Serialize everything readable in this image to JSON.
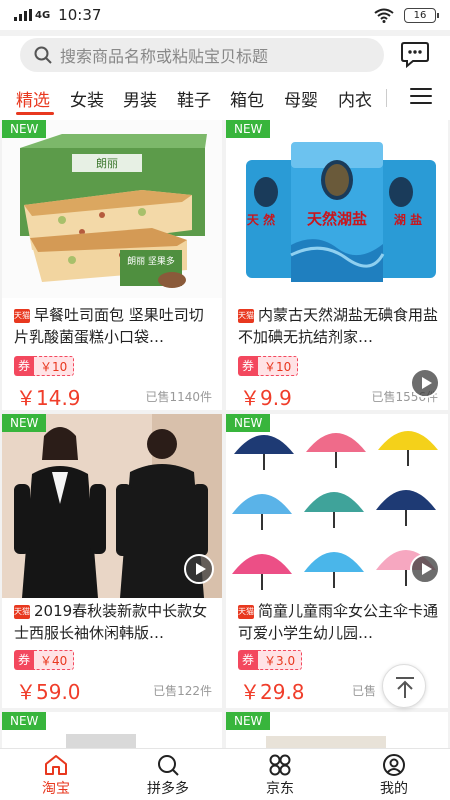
{
  "status": {
    "time": "10:37",
    "network": "4G",
    "battery": "16"
  },
  "search": {
    "placeholder": "搜索商品名称或粘贴宝贝标题"
  },
  "tabs": [
    "精选",
    "女装",
    "男装",
    "鞋子",
    "箱包",
    "母婴",
    "内衣"
  ],
  "active_tab": "精选",
  "badge_new": "NEW",
  "products": [
    {
      "title": "早餐吐司面包 坚果吐司切片乳酸菌蛋糕小口袋…",
      "store_tag": "天猫",
      "coupon_label": "券",
      "coupon": "￥10",
      "price": "￥14.9",
      "sold": "已售1140件",
      "image": "bread-box",
      "brand_text": "朗丽",
      "video": false
    },
    {
      "title": "内蒙古天然湖盐无碘食用盐不加碘无抗结剂家…",
      "store_tag": "天猫",
      "coupon_label": "券",
      "coupon": "￥10",
      "price": "￥9.9",
      "sold": "已售1556件",
      "image": "salt-bags",
      "brand_text": "天然湖盐",
      "video": true
    },
    {
      "title": "2019春秋装新款中长款女士西服长袖休闲韩版…",
      "store_tag": "天猫",
      "coupon_label": "券",
      "coupon": "￥40",
      "price": "￥59.0",
      "sold": "已售122件",
      "image": "women-blazer",
      "video": true
    },
    {
      "title": "简童儿童雨伞女公主伞卡通可爱小学生幼儿园…",
      "store_tag": "天猫",
      "coupon_label": "券",
      "coupon": "￥3.0",
      "price": "￥29.8",
      "sold": "已售",
      "image": "umbrellas",
      "video": true
    }
  ],
  "bottom_nav": [
    {
      "label": "淘宝",
      "icon": "home-icon"
    },
    {
      "label": "拼多多",
      "icon": "search-icon"
    },
    {
      "label": "京东",
      "icon": "grid-icon"
    },
    {
      "label": "我的",
      "icon": "user-icon"
    }
  ],
  "colors": {
    "accent": "#e8381f",
    "new_badge": "#38b53c",
    "price": "#f03d2a"
  }
}
